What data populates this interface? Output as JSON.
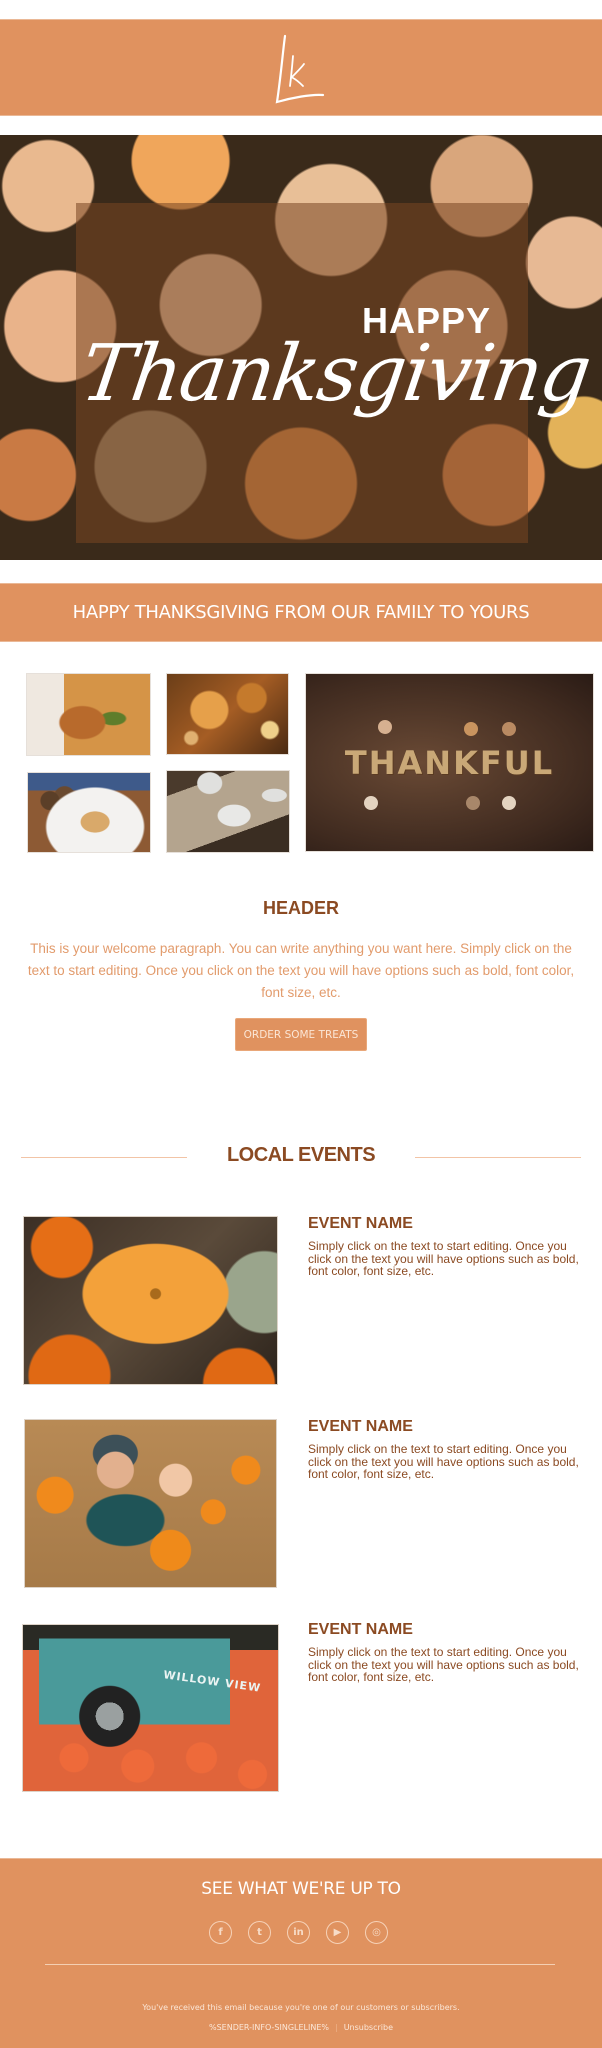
{
  "brand": {
    "logo_text": "Lk",
    "accent_color": "#e0925f",
    "heading_color": "#8b4a22",
    "body_text_color": "#e29b6c"
  },
  "hero": {
    "title_top": "HAPPY",
    "title_script": "Thanksgiving"
  },
  "tagline": "HAPPY THANKSGIVING FROM OUR FAMILY TO YOURS",
  "gallery": {
    "images": [
      {
        "name": "turkey-carving-photo"
      },
      {
        "name": "autumn-leaves-photo"
      },
      {
        "name": "pumpkin-pie-photo"
      },
      {
        "name": "table-setting-photo"
      },
      {
        "name": "thankful-sign-photo",
        "caption": "THANKFUL"
      }
    ]
  },
  "intro": {
    "header": "HEADER",
    "paragraph": "This is your welcome paragraph. You can write anything you want here. Simply click on the text to start editing. Once you click on the text you will have options such as bold, font color, font size, etc.",
    "cta_label": "ORDER SOME TREATS"
  },
  "events": {
    "title": "LOCAL EVENTS",
    "items": [
      {
        "name": "EVENT NAME",
        "description": "Simply click on the text to start editing. Once you click on the text you will have options such as bold, font color, font size, etc."
      },
      {
        "name": "EVENT NAME",
        "description": "Simply click on the text to start editing. Once you click on the text you will have options such as bold, font color, font size, etc."
      },
      {
        "name": "EVENT NAME",
        "description": "Simply click on the text to start editing. Once you click on the text you will have options such as bold, font color, font size, etc.",
        "photo_text": "WILLOW VIEW"
      }
    ]
  },
  "footer": {
    "title": "SEE WHAT WE'RE UP TO",
    "socials": [
      {
        "icon": "facebook-icon",
        "glyph": "f"
      },
      {
        "icon": "twitter-icon",
        "glyph": "t"
      },
      {
        "icon": "linkedin-icon",
        "glyph": "in"
      },
      {
        "icon": "youtube-icon",
        "glyph": "▶"
      },
      {
        "icon": "instagram-icon",
        "glyph": "◎"
      }
    ],
    "note": "You've received this email because you're one of our customers or subscribers.",
    "sender_info": "%SENDER-INFO-SINGLELINE%",
    "separator": "|",
    "unsubscribe_label": "Unsubscribe"
  }
}
